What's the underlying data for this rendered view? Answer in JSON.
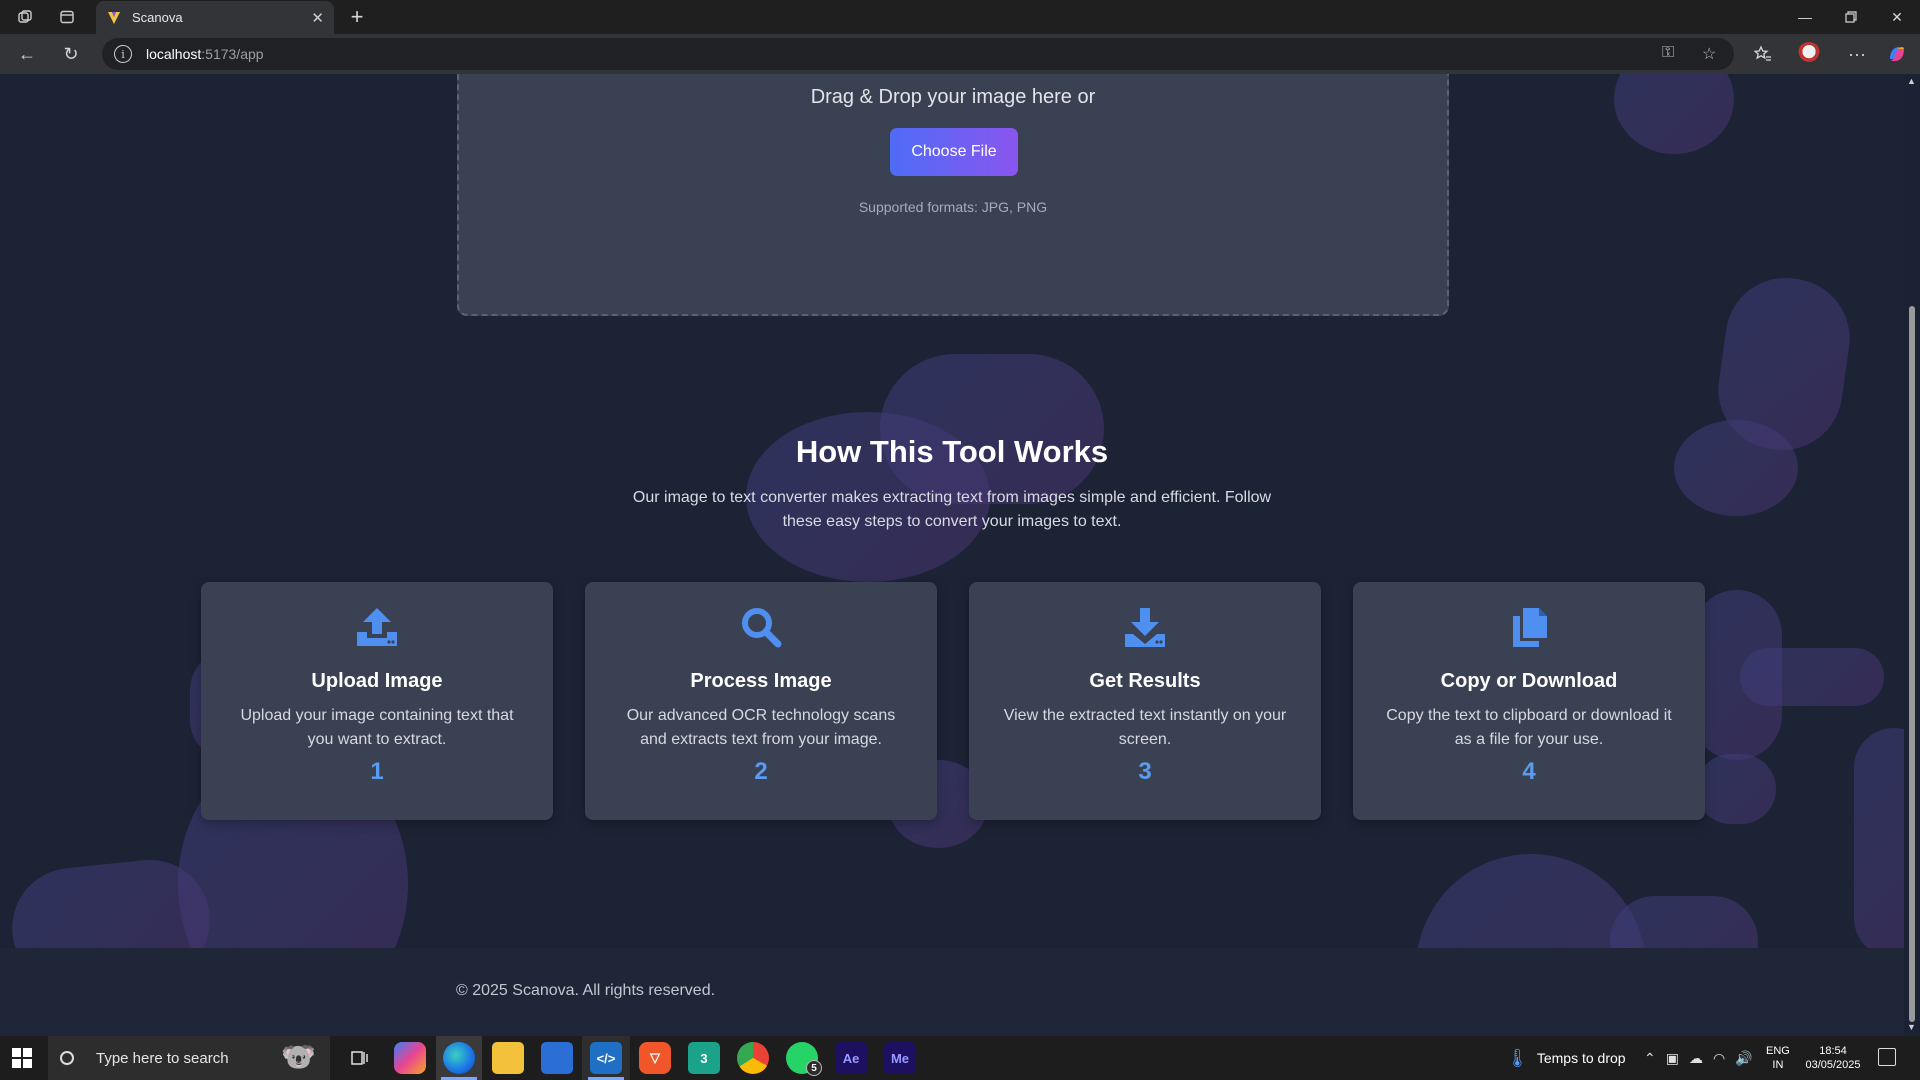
{
  "browser": {
    "tab_title": "Scanova",
    "url_host": "localhost",
    "url_path": ":5173/app"
  },
  "upload": {
    "drag_text": "Drag & Drop your image here or",
    "button_label": "Choose File",
    "formats_text": "Supported formats: JPG, PNG"
  },
  "how": {
    "title": "How This Tool Works",
    "description": "Our image to text converter makes extracting text from images simple and efficient. Follow these easy steps to convert your images to text."
  },
  "steps": [
    {
      "icon": "upload-icon",
      "title": "Upload Image",
      "description": "Upload your image containing text that you want to extract.",
      "number": "1"
    },
    {
      "icon": "search-icon",
      "title": "Process Image",
      "description": "Our advanced OCR technology scans and extracts text from your image.",
      "number": "2"
    },
    {
      "icon": "download-icon",
      "title": "Get Results",
      "description": "View the extracted text instantly on your screen.",
      "number": "3"
    },
    {
      "icon": "copy-icon",
      "title": "Copy or Download",
      "description": "Copy the text to clipboard or download it as a file for your use.",
      "number": "4"
    }
  ],
  "footer": {
    "copyright": "© 2025 Scanova. All rights reserved."
  },
  "taskbar": {
    "search_placeholder": "Type here to search",
    "weather": "Temps to drop",
    "lang_line1": "ENG",
    "lang_line2": "IN",
    "time": "18:54",
    "date": "03/05/2025",
    "whatsapp_badge": "5",
    "apps": [
      "Copilot",
      "Edge",
      "File Explorer",
      "Microsoft Store",
      "VS Code",
      "Brave",
      "App",
      "Chrome",
      "WhatsApp",
      "After Effects",
      "Media Encoder"
    ]
  },
  "colors": {
    "accent_start": "#4f6cf7",
    "accent_end": "#8a55ee",
    "step_number": "#5b9cf3",
    "page_bg": "#1c2335",
    "card_bg": "#394152"
  }
}
